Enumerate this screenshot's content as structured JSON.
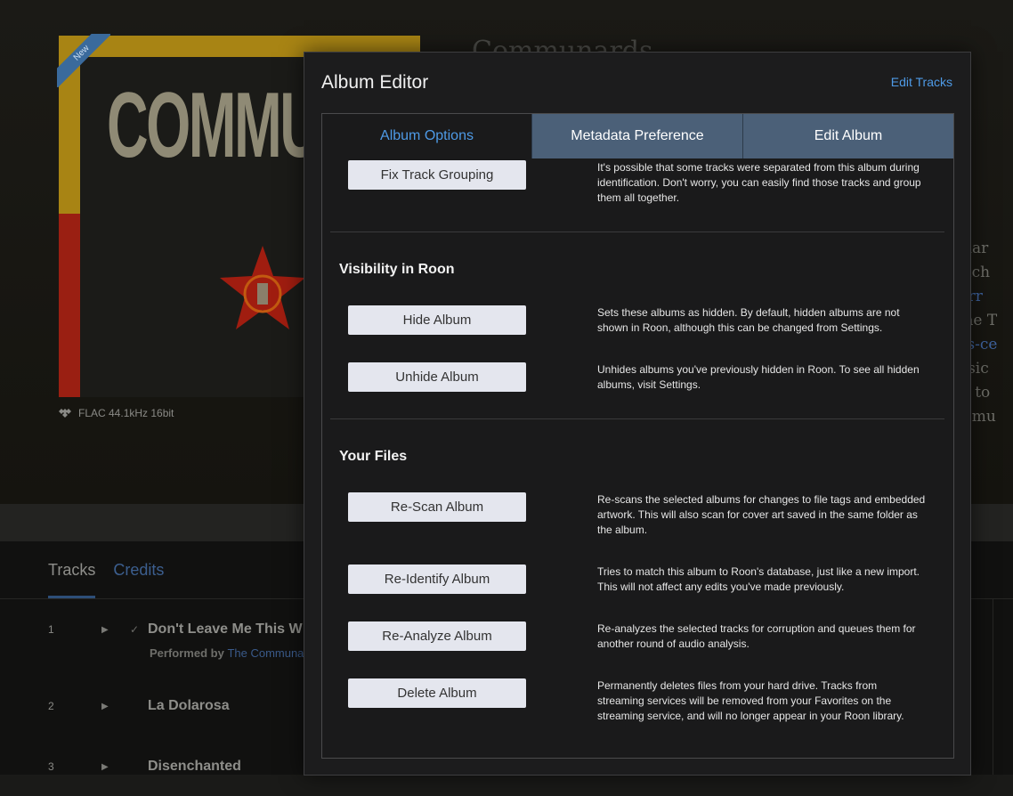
{
  "background": {
    "album_art": {
      "title_text": "COMMUNA",
      "badge": "New"
    },
    "format": "FLAC 44.1kHz 16bit",
    "artist_heading": "Communards",
    "bio_fragments": [
      "andar",
      "m ach",
      "Morr",
      "o the T",
      "bles-ce",
      "music",
      "has to",
      "ed, mu"
    ],
    "tabs": {
      "tracks": "Tracks",
      "credits": "Credits"
    },
    "tracks": [
      {
        "num": "1",
        "title": "Don't Leave Me This W",
        "performed_label": "Performed by",
        "performer": "The Communa"
      },
      {
        "num": "2",
        "title": "La Dolarosa"
      },
      {
        "num": "3",
        "title": "Disenchanted"
      }
    ]
  },
  "modal": {
    "title": "Album Editor",
    "edit_tracks_link": "Edit Tracks",
    "tabs": [
      {
        "label": "Album Options",
        "active": true
      },
      {
        "label": "Metadata Preference",
        "active": false
      },
      {
        "label": "Edit Album",
        "active": false
      }
    ],
    "sections": {
      "grouping": {
        "button": "Fix Track Grouping",
        "desc": "It's possible that some tracks were separated from this album during identification. Don't worry, you can easily find those tracks and group them all together."
      },
      "visibility": {
        "heading": "Visibility in Roon",
        "hide_button": "Hide Album",
        "hide_desc": "Sets these albums as hidden. By default, hidden albums are not shown in Roon, although this can be changed from Settings.",
        "unhide_button": "Unhide Album",
        "unhide_desc": "Unhides albums you've previously hidden in Roon. To see all hidden albums, visit Settings."
      },
      "files": {
        "heading": "Your Files",
        "rescan_button": "Re-Scan Album",
        "rescan_desc": "Re-scans the selected albums for changes to file tags and embedded artwork. This will also scan for cover art saved in the same folder as the album.",
        "reidentify_button": "Re-Identify Album",
        "reidentify_desc": "Tries to match this album to Roon's database, just like a new import. This will not affect any edits you've made previously.",
        "reanalyze_button": "Re-Analyze Album",
        "reanalyze_desc": "Re-analyzes the selected tracks for corruption and queues them for another round of audio analysis.",
        "delete_button": "Delete Album",
        "delete_desc": "Permanently deletes files from your hard drive. Tracks from streaming services will be removed from your Favorites on the streaming service, and will no longer appear in your Roon library."
      }
    }
  },
  "colors": {
    "accent": "#4e9ae6",
    "tab_inactive_bg": "#4b6078",
    "button_bg": "#e4e6ee"
  }
}
